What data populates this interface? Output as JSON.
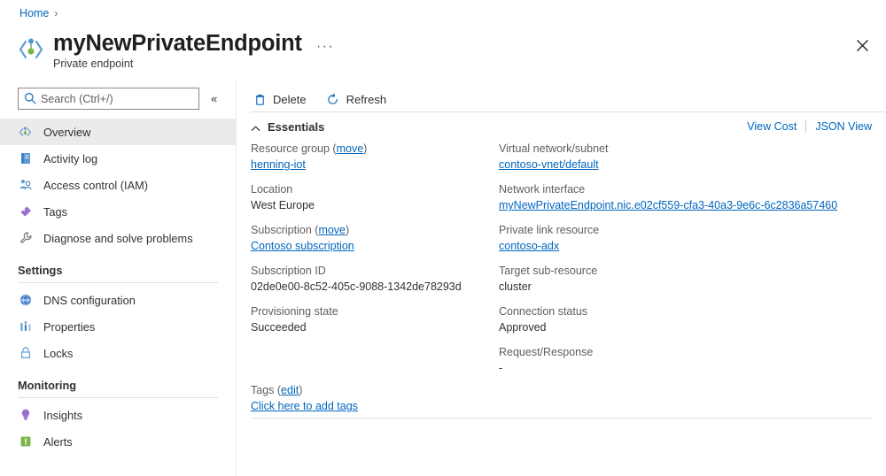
{
  "breadcrumb": {
    "home": "Home",
    "separator": "›"
  },
  "header": {
    "title": "myNewPrivateEndpoint",
    "subtitle": "Private endpoint",
    "more_label": "···",
    "resource_icon": "private-endpoint-icon",
    "close_icon": "close-icon"
  },
  "sidebar": {
    "search": {
      "placeholder": "Search (Ctrl+/)",
      "value": "",
      "icon": "search-icon"
    },
    "collapse": {
      "label": "«",
      "icon": "collapse-left-icon"
    },
    "items": [
      {
        "label": "Overview",
        "icon": "private-endpoint-icon",
        "active": true
      },
      {
        "label": "Activity log",
        "icon": "activity-log-icon",
        "active": false
      },
      {
        "label": "Access control (IAM)",
        "icon": "access-control-icon",
        "active": false
      },
      {
        "label": "Tags",
        "icon": "tag-icon",
        "active": false
      },
      {
        "label": "Diagnose and solve problems",
        "icon": "wrench-icon",
        "active": false
      }
    ],
    "groups": [
      {
        "title": "Settings",
        "items": [
          {
            "label": "DNS configuration",
            "icon": "dns-icon"
          },
          {
            "label": "Properties",
            "icon": "properties-icon"
          },
          {
            "label": "Locks",
            "icon": "lock-icon"
          }
        ]
      },
      {
        "title": "Monitoring",
        "items": [
          {
            "label": "Insights",
            "icon": "lightbulb-icon"
          },
          {
            "label": "Alerts",
            "icon": "alert-icon"
          }
        ]
      }
    ]
  },
  "commandbar": {
    "delete": {
      "label": "Delete",
      "icon": "trash-icon"
    },
    "refresh": {
      "label": "Refresh",
      "icon": "refresh-icon"
    }
  },
  "essentials": {
    "title": "Essentials",
    "collapse_icon": "chevron-up-icon",
    "view_cost": "View Cost",
    "json_view": "JSON View",
    "left_column": [
      {
        "label": "Resource group",
        "label_link": "move",
        "value": "henning-iot",
        "value_is_link": true
      },
      {
        "label": "Location",
        "value": "West Europe",
        "value_is_link": false
      },
      {
        "label": "Subscription",
        "label_link": "move",
        "value": "Contoso subscription",
        "value_is_link": true
      },
      {
        "label": "Subscription ID",
        "value": "02de0e00-8c52-405c-9088-1342de78293d",
        "value_is_link": false
      },
      {
        "label": "Provisioning state",
        "value": "Succeeded",
        "value_is_link": false
      }
    ],
    "right_column": [
      {
        "label": "Virtual network/subnet",
        "value": "contoso-vnet/default",
        "value_is_link": true
      },
      {
        "label": "Network interface",
        "value": "myNewPrivateEndpoint.nic.e02cf559-cfa3-40a3-9e6c-6c2836a57460",
        "value_is_link": true
      },
      {
        "label": "Private link resource",
        "value": "contoso-adx",
        "value_is_link": true
      },
      {
        "label": "Target sub-resource",
        "value": "cluster",
        "value_is_link": false
      },
      {
        "label": "Connection status",
        "value": "Approved",
        "value_is_link": false
      },
      {
        "label": "Request/Response",
        "value": "-",
        "value_is_link": false
      }
    ],
    "tags": {
      "label": "Tags",
      "label_link": "edit",
      "value": "Click here to add tags"
    }
  },
  "colors": {
    "link": "#0066bf",
    "active_nav_bg": "#edebe9",
    "label_gray": "#605e5c",
    "border": "#e1dfdd"
  }
}
